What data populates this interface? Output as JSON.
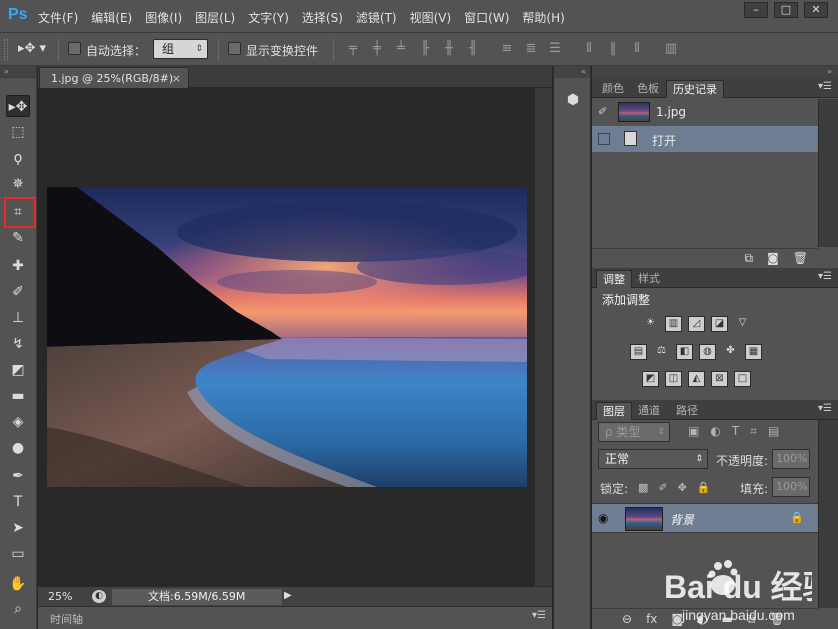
{
  "app": {
    "logo": "Ps"
  },
  "menu": [
    "文件(F)",
    "编辑(E)",
    "图像(I)",
    "图层(L)",
    "文字(Y)",
    "选择(S)",
    "滤镜(T)",
    "视图(V)",
    "窗口(W)",
    "帮助(H)"
  ],
  "window_controls": {
    "minimize": "–",
    "maximize": "□",
    "close": "✕"
  },
  "options": {
    "tool_glyph": "▸✥ ▾",
    "auto_select_label": "自动选择：",
    "auto_select_value": "组",
    "show_transform_label": "显示变换控件"
  },
  "tools": [
    {
      "name": "move-tool-icon",
      "glyph": "▸✥"
    },
    {
      "name": "marquee-tool-icon",
      "glyph": "⬚"
    },
    {
      "name": "lasso-tool-icon",
      "glyph": "ϙ"
    },
    {
      "name": "magic-wand-tool-icon",
      "glyph": "✵"
    },
    {
      "name": "crop-tool-icon",
      "glyph": "⌗"
    },
    {
      "name": "eyedropper-tool-icon",
      "glyph": "✎"
    },
    {
      "name": "healing-brush-tool-icon",
      "glyph": "✚"
    },
    {
      "name": "brush-tool-icon",
      "glyph": "✐"
    },
    {
      "name": "clone-stamp-tool-icon",
      "glyph": "⊥"
    },
    {
      "name": "history-brush-tool-icon",
      "glyph": "↯"
    },
    {
      "name": "eraser-tool-icon",
      "glyph": "◩"
    },
    {
      "name": "gradient-tool-icon",
      "glyph": "▬"
    },
    {
      "name": "blur-tool-icon",
      "glyph": "◈"
    },
    {
      "name": "dodge-tool-icon",
      "glyph": "●"
    },
    {
      "name": "pen-tool-icon",
      "glyph": "✒"
    },
    {
      "name": "type-tool-icon",
      "glyph": "T"
    },
    {
      "name": "path-selection-tool-icon",
      "glyph": "➤"
    },
    {
      "name": "shape-tool-icon",
      "glyph": "▭"
    },
    {
      "name": "hand-tool-icon",
      "glyph": "✋"
    },
    {
      "name": "zoom-tool-icon",
      "glyph": "⌕"
    }
  ],
  "document": {
    "tab_title": "1.jpg @ 25%(RGB/8#)",
    "tab_close": "×"
  },
  "status": {
    "zoom": "25%",
    "doc_info": "文档:6.59M/6.59M",
    "arrow": "▶"
  },
  "timeline": {
    "tab": "时间轴"
  },
  "panel_history": {
    "tabs": [
      "颜色",
      "色板",
      "历史记录"
    ],
    "snapshot_label": "1.jpg",
    "items": [
      "打开"
    ]
  },
  "panel_adjust": {
    "tabs": [
      "调整",
      "样式"
    ],
    "title": "添加调整"
  },
  "panel_layers": {
    "tabs": [
      "图层",
      "通道",
      "路径"
    ],
    "filter": "ρ 类型",
    "blend_mode": "正常",
    "opacity_label": "不透明度:",
    "opacity_value": "100%",
    "lock_label": "锁定:",
    "fill_label": "填充:",
    "fill_value": "100%",
    "layer_name": "背景"
  },
  "watermark": {
    "brand": "Bai du 经验",
    "url": "jingyan.baidu.com"
  },
  "colors": {
    "highlight": "#e6292b",
    "selected_row": "#6e7d92"
  }
}
